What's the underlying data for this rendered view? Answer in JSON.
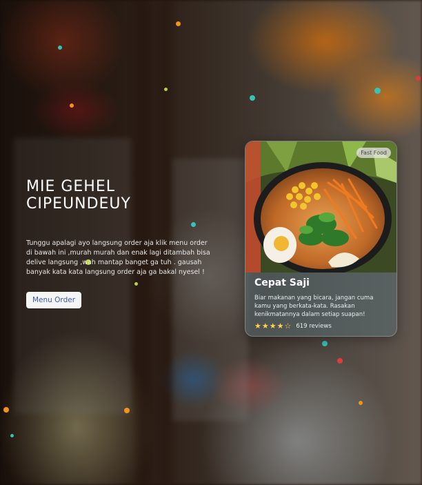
{
  "hero": {
    "title_line1": "MIE GEHEL",
    "title_line2": "CIPEUNDEUY",
    "description": "Tunggu apalagi ayo langsung order aja klik menu order di bawah ini ,murah murah dan enak lagi ditambah bisa delive langsung ,wah mantap banget ga tuh . gausah banyak kata kata langsung order aja ga bakal nyesel !",
    "button_label": "Menu Order"
  },
  "card": {
    "badge": "Fast Food",
    "title": "Cepat Saji",
    "text": "Biar makanan yang bicara, jangan cuma kamu yang berkata-kata. Rasakan kenikmatannya dalam setiap suapan!",
    "stars": "★★★★☆",
    "rating": 4,
    "reviews": "619 reviews"
  },
  "colors": {
    "button_text": "#3a5aa8",
    "star": "#ffd34a",
    "dot_orange": "#f5921e",
    "dot_teal": "#35c3b5",
    "dot_red": "#e03b3b",
    "dot_lime": "#b5d636"
  }
}
